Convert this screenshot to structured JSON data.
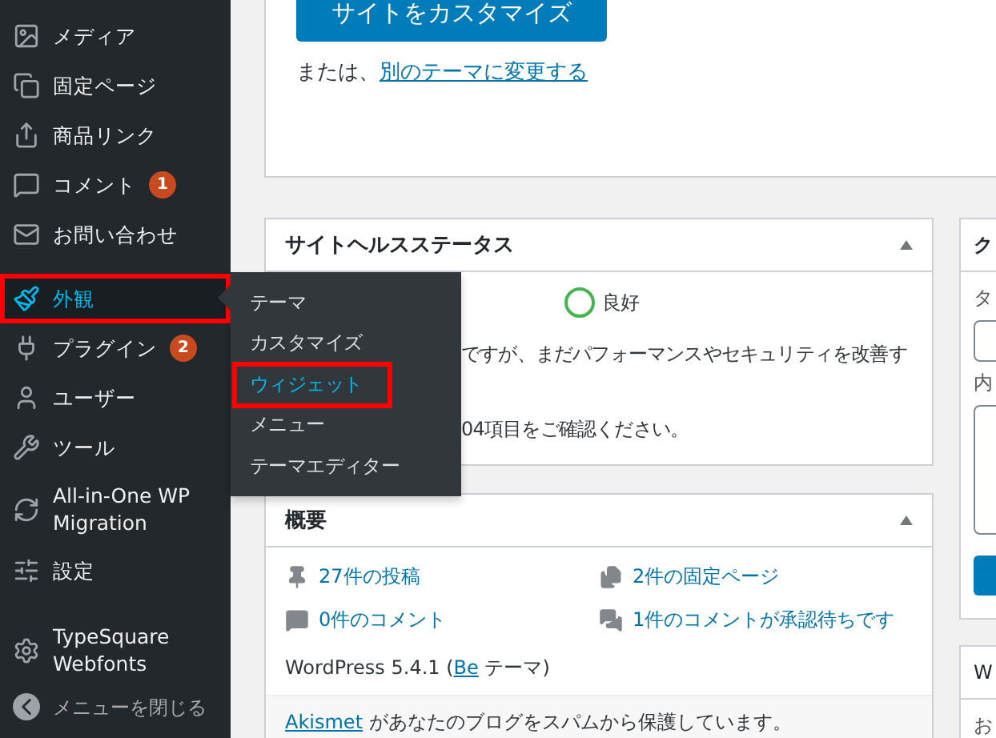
{
  "sidebar": {
    "groups": [
      [
        {
          "label": "メディア",
          "selected": false,
          "highlighted": false
        },
        {
          "label": "固定ページ",
          "selected": false,
          "highlighted": false
        },
        {
          "label": "商品リンク",
          "selected": false,
          "highlighted": false
        },
        {
          "label": "コメント",
          "badge": "1",
          "selected": false,
          "highlighted": false
        },
        {
          "label": "お問い合わせ",
          "selected": false,
          "highlighted": false
        }
      ],
      [
        {
          "label": "外観",
          "selected": true,
          "highlighted": true
        },
        {
          "label": "プラグイン",
          "badge": "2",
          "selected": false,
          "highlighted": false
        },
        {
          "label": "ユーザー",
          "selected": false,
          "highlighted": false
        },
        {
          "label": "ツール",
          "selected": false,
          "highlighted": false
        },
        {
          "label": "All-in-One WP Migration",
          "selected": false,
          "highlighted": false
        },
        {
          "label": "設定",
          "selected": false,
          "highlighted": false
        }
      ],
      [
        {
          "label": "TypeSquare Webfonts",
          "selected": false,
          "highlighted": false
        }
      ]
    ],
    "collapse": "メニューを閉じる"
  },
  "flyout": [
    {
      "label": "テーマ",
      "selected": false,
      "highlighted": false
    },
    {
      "label": "カスタマイズ",
      "selected": false,
      "highlighted": false
    },
    {
      "label": "ウィジェット",
      "selected": true,
      "highlighted": true
    },
    {
      "label": "メニュー",
      "selected": false,
      "highlighted": false
    },
    {
      "label": "テーマエディター",
      "selected": false,
      "highlighted": false
    }
  ],
  "welcome": {
    "button": "サイトをカスタマイズ",
    "or_text": "または、",
    "link": "別のテーマに変更する"
  },
  "site_health": {
    "title": "サイトヘルスステータス",
    "status": "良好",
    "line_1": "ですが、まだパフォーマンスやセキュリティを改善す",
    "line_2": "04項目をご確認ください。"
  },
  "overview": {
    "title": "概要",
    "stats": [
      {
        "text": "27件の投稿"
      },
      {
        "text": "2件の固定ページ"
      },
      {
        "text": "0件のコメント"
      },
      {
        "text": "1件のコメントが承認待ちです"
      }
    ],
    "version_text": "WordPress 5.4.1 (",
    "theme_link": "Be",
    "version_suffix": " テーマ)",
    "akismet_link": "Akismet",
    "akismet_text": " があなたのブログをスパムから保護しています。"
  },
  "quick_draft": {
    "title": "ク",
    "title_label": "タ",
    "content_label": "内"
  },
  "events": {
    "title": "W",
    "text": "お"
  }
}
